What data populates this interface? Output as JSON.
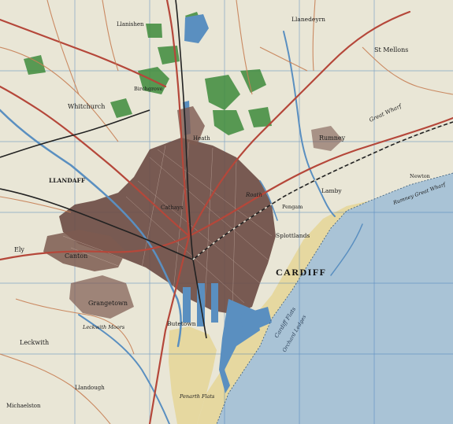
{
  "map": {
    "colors": {
      "land": "#e9e6d6",
      "sea": "#a9c3d6",
      "foreshore": "#e6d8a0",
      "urban": "#6b4a44",
      "roads_main": "#b5473a",
      "roads_minor": "#c77f55",
      "woods": "#3e8b3c",
      "water": "#5a8fc0",
      "rail": "#222222",
      "grid": "#2f6fb5"
    },
    "places": {
      "cardiff": "CARDIFF",
      "llandaff": "LLANDAFF",
      "canton": "Canton",
      "whitchurch": "Whitchurch",
      "grangetown": "Grangetown",
      "leckwith": "Leckwith",
      "st_mellons": "St Mellons",
      "roath": "Roath",
      "lamby": "Lamby",
      "splottlands": "Splottlands",
      "pengam": "Pengam",
      "rumney": "Rumney",
      "llanishen": "Llanishen",
      "llanedeyrn": "Llanedeyrn",
      "michaelston": "Michaelston",
      "penarth_flats": "Penarth Flats",
      "cardiff_flats": "Cardiff Flats",
      "orchard_ledges": "Orchard Ledges",
      "great_wharf": "Great Wharf",
      "rumney_great_wharf": "Rumney Great Wharf",
      "newton": "Newton",
      "butetown": "Butetown",
      "ely": "Ely",
      "heath": "Heath",
      "cathays": "Cathays",
      "llandough": "Llandough",
      "leckwith_moors": "Leckwith Moors",
      "birchgrove": "Birchgrove"
    }
  }
}
